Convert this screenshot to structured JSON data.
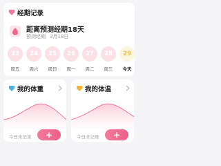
{
  "period": {
    "title": "经期记录",
    "countdown": "距离预测经期18天",
    "predict_label": "预测经期",
    "predict_date": "3月18日",
    "days": [
      {
        "num": "23",
        "weekday": "周五"
      },
      {
        "num": "24",
        "weekday": "周六"
      },
      {
        "num": "25",
        "weekday": "周日"
      },
      {
        "num": "26",
        "weekday": "周一"
      },
      {
        "num": "27",
        "weekday": "周二"
      },
      {
        "num": "28",
        "weekday": "周三"
      },
      {
        "num": "29",
        "weekday": "今天",
        "today": true
      }
    ]
  },
  "weight": {
    "title": "我的体重",
    "no_record": "今日未记录",
    "add_label": "+"
  },
  "temperature": {
    "title": "我的体温",
    "no_record": "今日未记录",
    "add_label": "+"
  },
  "colors": {
    "accent": "#ec5f86",
    "day_circle": "#fbe1e6",
    "today_circle": "#fbf4df",
    "today_text": "#e9c24c",
    "weight_icon": "#4fb3e0",
    "temperature_icon": "#f2b53a"
  },
  "icons": {
    "title_icon": "period-tag-icon",
    "drop_icon": "pink-drop-icon",
    "weight_icon": "blue-tag-icon",
    "temperature_icon": "yellow-tag-icon"
  }
}
